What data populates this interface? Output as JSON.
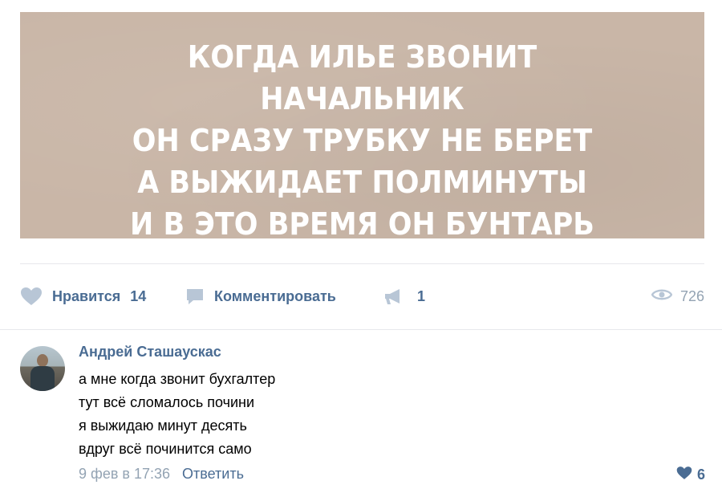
{
  "post": {
    "image_text": [
      "КОГДА ИЛЬЕ ЗВОНИТ",
      "НАЧАЛЬНИК",
      "ОН СРАЗУ ТРУБКУ НЕ БЕРЕТ",
      "А ВЫЖИДАЕТ ПОЛМИНУТЫ",
      "И В ЭТО ВРЕМЯ ОН БУНТАРЬ"
    ],
    "image_background_color": "#c9b6a7"
  },
  "actions": {
    "like": {
      "label": "Нравится",
      "count": "14",
      "icon": "heart-icon"
    },
    "comment": {
      "label": "Комментировать",
      "icon": "comment-bubble-icon"
    },
    "share": {
      "count": "1",
      "icon": "megaphone-icon"
    },
    "views": {
      "count": "726",
      "icon": "eye-icon"
    }
  },
  "comments": [
    {
      "author": "Андрей Сташаускас",
      "lines": [
        "а мне когда звонит бухгалтер",
        "тут всё сломалось почини",
        "я выжидаю минут десять",
        "вдруг всё починится само"
      ],
      "date": "9 фев в 17:36",
      "reply_label": "Ответить",
      "likes": "6",
      "like_icon": "heart-icon"
    }
  ],
  "colors": {
    "link": "#4a6c93",
    "muted": "#93a3b3",
    "icon": "#b8c6d6",
    "divider": "#e7e8ec"
  }
}
